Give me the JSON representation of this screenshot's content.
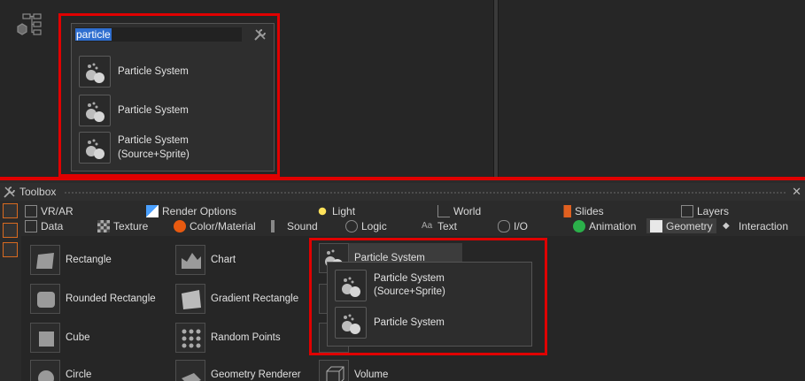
{
  "search": {
    "query": "particle",
    "results": [
      {
        "label": "Particle System"
      },
      {
        "label": "Particle System"
      },
      {
        "label": "Particle System\n(Source+Sprite)"
      }
    ]
  },
  "toolbox": {
    "title": "Toolbox",
    "close": "✕",
    "categories_row1": [
      "VR/AR",
      "Render Options",
      "Light",
      "World",
      "Slides",
      "Layers"
    ],
    "categories_row2": [
      "Data",
      "Texture",
      "Color/Material",
      "Sound",
      "Logic",
      "Text",
      "I/O",
      "Animation",
      "Geometry",
      "Interaction"
    ],
    "active_category": "Geometry",
    "tools_col1": [
      "Rectangle",
      "Rounded Rectangle",
      "Cube",
      "Circle"
    ],
    "tools_col2": [
      "Chart",
      "Gradient Rectangle",
      "Random Points",
      "Geometry Renderer"
    ],
    "tools_col3_hovered": "Particle System",
    "tools_col3_last": "Volume",
    "submenu": [
      "Particle System\n(Source+Sprite)",
      "Particle System"
    ]
  },
  "colors": {
    "highlight_red": "#e00000",
    "selection_blue": "#2f6ecf",
    "side_accent": "#d86a20"
  }
}
